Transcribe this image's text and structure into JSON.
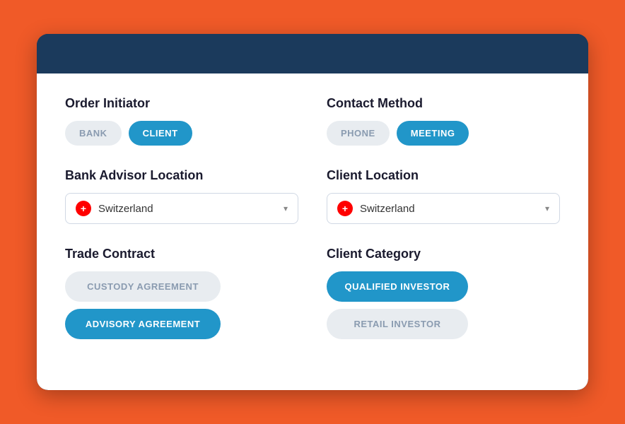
{
  "header": {
    "bg": "#1b3a5c"
  },
  "orderInitiator": {
    "title": "Order Initiator",
    "options": [
      {
        "label": "BANK",
        "active": false
      },
      {
        "label": "CLIENT",
        "active": true
      }
    ]
  },
  "contactMethod": {
    "title": "Contact Method",
    "options": [
      {
        "label": "PHONE",
        "active": false
      },
      {
        "label": "MEETING",
        "active": true
      }
    ]
  },
  "bankAdvisorLocation": {
    "title": "Bank Advisor Location",
    "value": "Switzerland"
  },
  "clientLocation": {
    "title": "Client Location",
    "value": "Switzerland"
  },
  "tradeContract": {
    "title": "Trade Contract",
    "options": [
      {
        "label": "CUSTODY AGREEMENT",
        "active": false
      },
      {
        "label": "ADVISORY AGREEMENT",
        "active": true
      }
    ]
  },
  "clientCategory": {
    "title": "Client Category",
    "options": [
      {
        "label": "QUALIFIED INVESTOR",
        "active": true
      },
      {
        "label": "RETAIL INVESTOR",
        "active": false
      }
    ]
  }
}
